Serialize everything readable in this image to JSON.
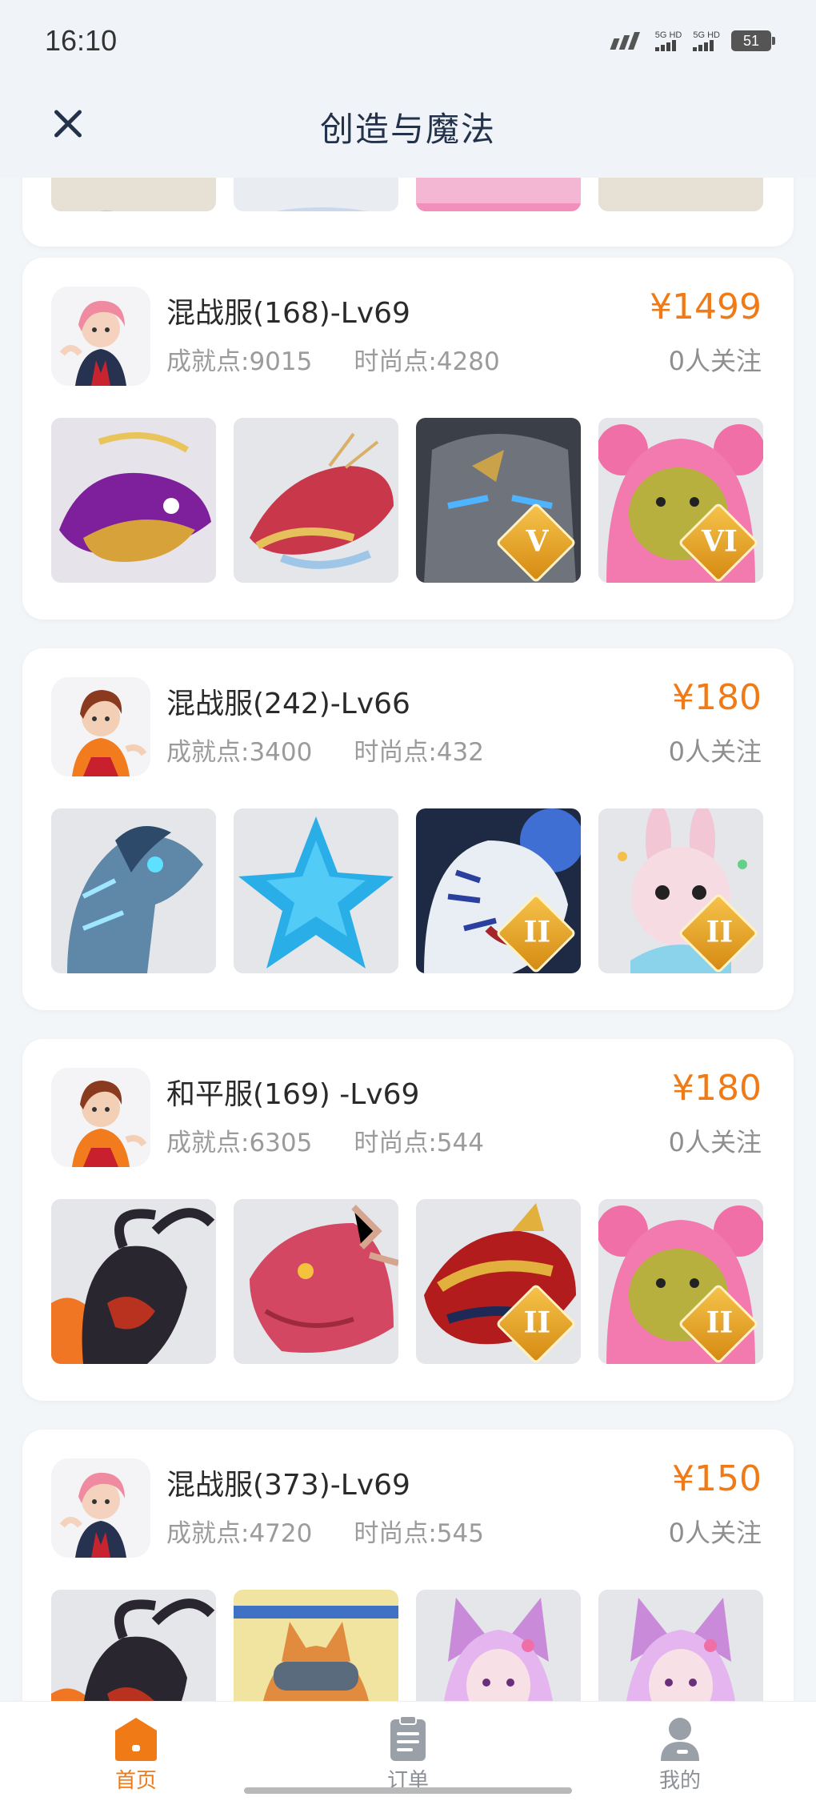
{
  "status_bar": {
    "time": "16:10",
    "sim1_label": "5G HD",
    "sim2_label": "5G HD",
    "battery": "51"
  },
  "header": {
    "title": "创造与魔法",
    "close_icon": "close-icon"
  },
  "top_card_partial": {
    "thumb_colors": [
      "#e8c35a",
      "#c9d8ec",
      "#f38fbd",
      "#d79a3c"
    ]
  },
  "listings": [
    {
      "title": "混战服(168)-Lv69",
      "achievement": "成就点:9015",
      "fashion": "时尚点:4280",
      "price": "¥1499",
      "follow": "0人关注",
      "avatar": "pink-hair-girl",
      "thumbs": [
        {
          "icon": "fish-mount",
          "badge": ""
        },
        {
          "icon": "red-dragon",
          "badge": ""
        },
        {
          "icon": "stone-golem",
          "badge": "V"
        },
        {
          "icon": "pink-bear",
          "badge": "VI"
        }
      ]
    },
    {
      "title": "混战服(242)-Lv66",
      "achievement": "成就点:3400",
      "fashion": "时尚点:432",
      "price": "¥180",
      "follow": "0人关注",
      "avatar": "red-boy",
      "thumbs": [
        {
          "icon": "ice-horse",
          "badge": ""
        },
        {
          "icon": "blue-star",
          "badge": ""
        },
        {
          "icon": "white-tiger",
          "badge": "II"
        },
        {
          "icon": "pink-rabbit",
          "badge": "II"
        }
      ]
    },
    {
      "title": "和平服(169) -Lv69",
      "achievement": "成就点:6305",
      "fashion": "时尚点:544",
      "price": "¥180",
      "follow": "0人关注",
      "avatar": "red-boy",
      "thumbs": [
        {
          "icon": "black-goat-beast",
          "badge": ""
        },
        {
          "icon": "red-dragon-head",
          "badge": ""
        },
        {
          "icon": "gold-dragon",
          "badge": "II"
        },
        {
          "icon": "pink-bear",
          "badge": "II"
        }
      ]
    },
    {
      "title": "混战服(373)-Lv69",
      "achievement": "成就点:4720",
      "fashion": "时尚点:545",
      "price": "¥150",
      "follow": "0人关注",
      "avatar": "pink-hair-girl",
      "thumbs": [
        {
          "icon": "black-goat-beast",
          "badge": ""
        },
        {
          "icon": "corgi-pilot",
          "badge": ""
        },
        {
          "icon": "fox-girl",
          "badge": ""
        },
        {
          "icon": "fox-girl",
          "badge": ""
        }
      ]
    }
  ],
  "bottom_nav": {
    "items": [
      {
        "label": "首页",
        "icon": "home-icon",
        "active": true
      },
      {
        "label": "订单",
        "icon": "order-icon",
        "active": false
      },
      {
        "label": "我的",
        "icon": "profile-icon",
        "active": false
      }
    ],
    "accent": "#f07a16"
  },
  "colors": {
    "price": "#f07a16",
    "title": "#23324a"
  }
}
